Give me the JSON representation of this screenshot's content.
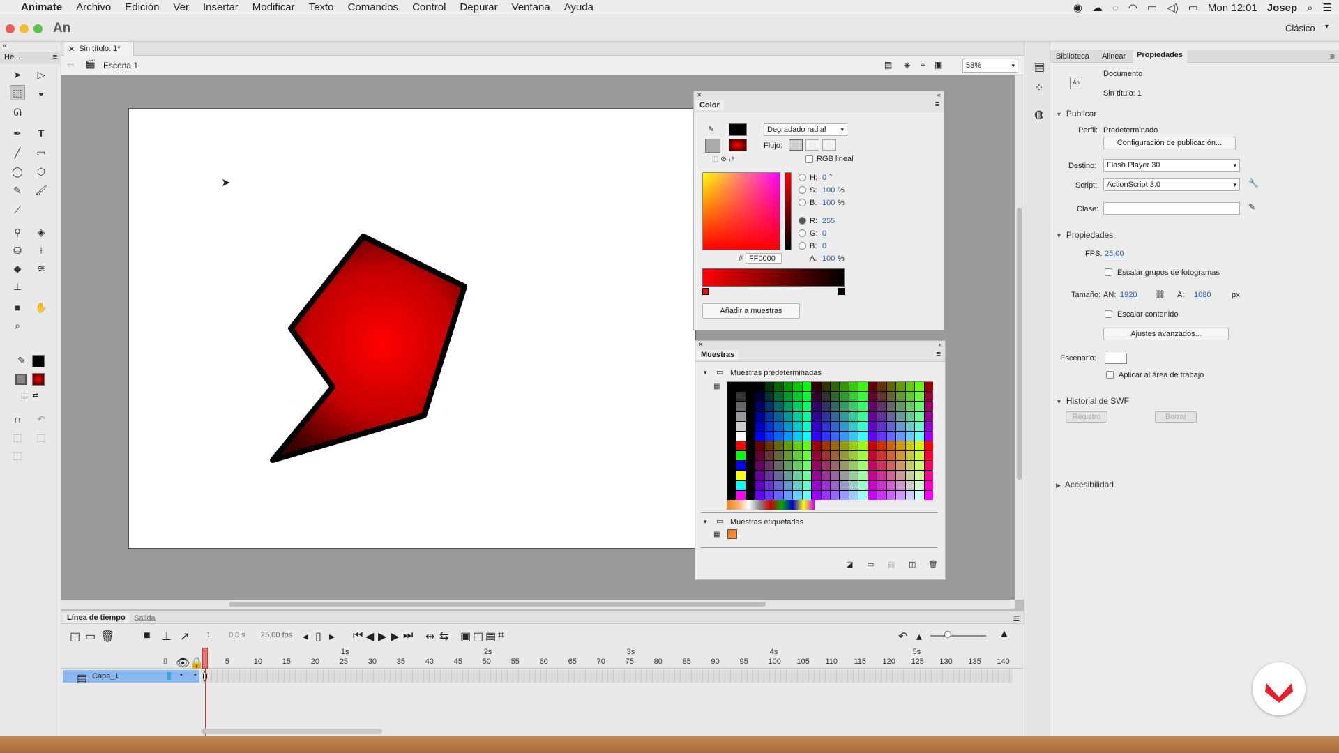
{
  "menubar": {
    "app": "Animate",
    "items": [
      "Archivo",
      "Edición",
      "Ver",
      "Insertar",
      "Modificar",
      "Texto",
      "Comandos",
      "Control",
      "Depurar",
      "Ventana",
      "Ayuda"
    ],
    "clock": "Mon 12:01",
    "user": "Josep"
  },
  "titlebar": {
    "logo": "An",
    "workspace": "Clásico"
  },
  "doc": {
    "tab": "Sin título: 1*",
    "scene": "Escena 1",
    "zoom": "58%",
    "panel_short": "He..."
  },
  "color_panel": {
    "title": "Color",
    "fill_type": "Degradado radial",
    "flow_label": "Flujo:",
    "linear_rgb": "RGB lineal",
    "h_label": "H:",
    "h": "0",
    "h_unit": "°",
    "s_label": "S:",
    "s": "100",
    "s_unit": "%",
    "b_label": "B:",
    "b": "100",
    "b_unit": "%",
    "r_label": "R:",
    "r": "255",
    "g_label": "G:",
    "g": "0",
    "bl_label": "B:",
    "bl": "0",
    "hash": "#",
    "hex": "FF0000",
    "a_label": "A:",
    "a": "100",
    "a_unit": "%",
    "add_button": "Añadir a muestras"
  },
  "swatches_panel": {
    "title": "Muestras",
    "default_group": "Muestras predeterminadas",
    "tagged_group": "Muestras etiquetadas"
  },
  "timeline": {
    "tabs": [
      "Línea de tiempo",
      "Salida"
    ],
    "time": "0,0 s",
    "fps": "25,00 fps",
    "frame": "1",
    "layer": "Capa_1",
    "seconds": [
      "1s",
      "2s",
      "3s",
      "4s",
      "5s"
    ],
    "frames": [
      "1",
      "5",
      "10",
      "15",
      "20",
      "25",
      "30",
      "35",
      "40",
      "45",
      "50",
      "55",
      "60",
      "65",
      "70",
      "75",
      "80",
      "85",
      "90",
      "95",
      "100",
      "105",
      "110",
      "115",
      "120",
      "125",
      "130",
      "135",
      "140",
      "1"
    ]
  },
  "properties": {
    "tabs": [
      "Biblioteca",
      "Alinear",
      "Propiedades"
    ],
    "doc_label": "Documento",
    "doc_name": "Sin título: 1",
    "publish_section": "Publicar",
    "profile_label": "Perfil:",
    "profile": "Predeterminado",
    "publish_settings": "Configuración de publicación...",
    "target_label": "Destino:",
    "target": "Flash Player 30",
    "script_label": "Script:",
    "script": "ActionScript 3.0",
    "class_label": "Clase:",
    "props_section": "Propiedades",
    "fps_label": "FPS:",
    "fps": "25,00",
    "scale_frames": "Escalar grupos de fotogramas",
    "size_label": "Tamaño:",
    "w_label": "AN:",
    "w": "1920",
    "h_label": "A:",
    "h": "1080",
    "unit": "px",
    "scale_content": "Escalar contenido",
    "advanced": "Ajustes avanzados...",
    "stage_label": "Escenario:",
    "apply_work": "Aplicar al área de trabajo",
    "swf_section": "Historial de SWF",
    "log": "Registro",
    "clear": "Borrar",
    "access_section": "Accesibilidad"
  },
  "colors": {
    "accent": "#ff0000",
    "stage_bg": "#ffffff",
    "dock": "#9a9a9a"
  }
}
